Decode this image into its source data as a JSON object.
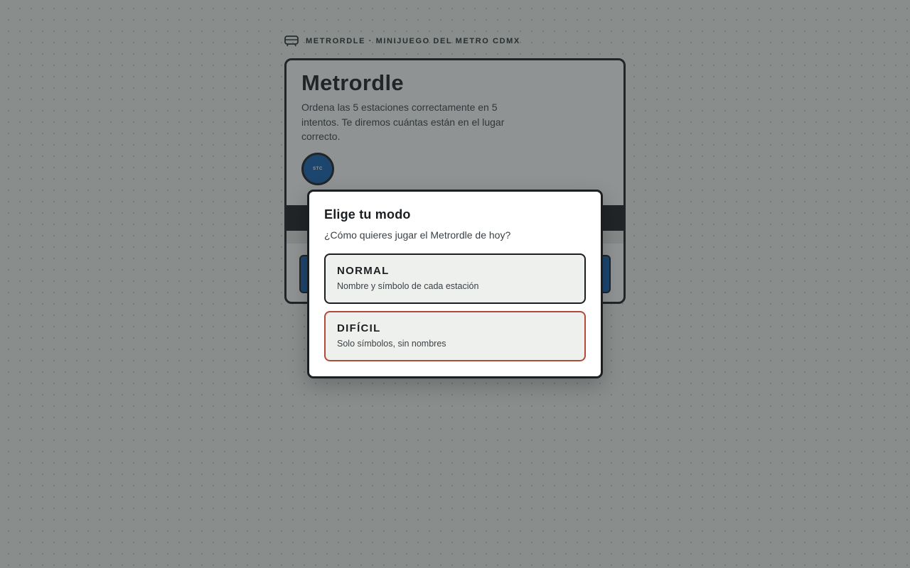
{
  "header": {
    "brand": "METRORDLE · MINIJUEGO DEL METRO CDMX",
    "icon": "train-icon"
  },
  "card": {
    "title": "Metrordle",
    "description": "Ordena las 5 estaciones correctamente en 5 intentos. Te diremos cuántas están en el lugar correcto.",
    "badge": "STC"
  },
  "modal": {
    "title": "Elige tu modo",
    "subtitle": "¿Cómo quieres jugar el Metrordle de hoy?",
    "options": [
      {
        "title": "NORMAL",
        "description": "Nombre y símbolo de cada estación"
      },
      {
        "title": "DIFÍCIL",
        "description": "Solo símbolos, sin nombres"
      }
    ]
  },
  "colors": {
    "accent_blue": "#1561b0",
    "ink": "#1c1f22",
    "hard_border": "#b24a3a"
  }
}
